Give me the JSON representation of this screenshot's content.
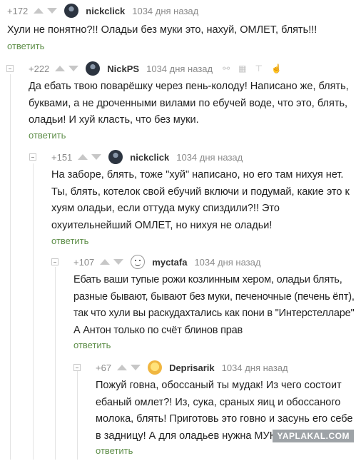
{
  "comments": [
    {
      "rating": "+172",
      "author": "nickclick",
      "date": "1034 дня назад",
      "text": "Хули не понятно?!! Оладьи без муки это, нахуй, ОМЛЕТ, блять!!!",
      "reply": "ответить"
    },
    {
      "rating": "+222",
      "author": "NickPS",
      "date": "1034 дня назад",
      "text": "Да ебать твою поварёшку через пень-колоду! Написано же, блять, буквами, а не дроченными вилами по ебучей воде, что это, блять, оладьи! И хуй класть, что без муки.",
      "reply": "ответить"
    },
    {
      "rating": "+151",
      "author": "nickclick",
      "date": "1034 дня назад",
      "text": "На заборе, блять, тоже \"хуй\" написано, но его там нихуя нет. Ты, блять, котелок свой ебучий включи и подумай, какие это к хуям оладьи, если оттуда муку спиздили?!! Это охуительнейший ОМЛЕТ, но нихуя не оладьи!",
      "reply": "ответить"
    },
    {
      "rating": "+107",
      "author": "myctafa",
      "date": "1034 дня назад",
      "text": "Ебать ваши тупые рожи козлинным хером, оладьи блять, разные бывают, бывают без муки, печеночные (печень ёпт), так что хули вы раскудахтались как пони в \"Интерстелларе\" А Антон только по счёт блинов прав",
      "reply": "ответить"
    },
    {
      "rating": "+67",
      "author": "Deprisarik",
      "date": "1034 дня назад",
      "text": "Пожуй говна, обоссаный ты мудак! Из чего состоит ебаный омлет?! Из, сука, сраных яиц и обоссаного молока, блять! Приготовь это говно и засунь его себе в задницу! А для оладьев нужна МУКА!",
      "reply": "ответить"
    }
  ],
  "icons": [
    "link-icon",
    "save-icon",
    "pin-icon",
    "hand-icon"
  ],
  "watermark": "YAPLAKAL.COM"
}
